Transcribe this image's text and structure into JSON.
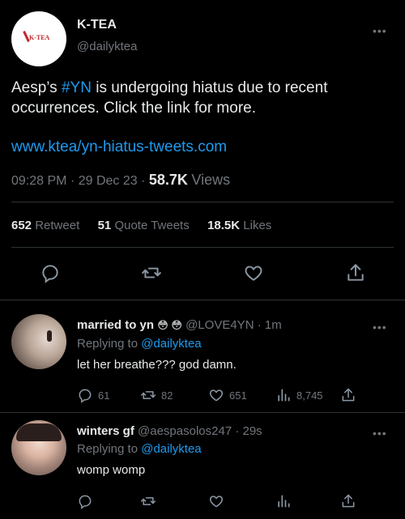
{
  "header": {
    "display_name": "K-TEA",
    "handle": "@dailyktea",
    "logo_text": "K-TEA"
  },
  "tweet": {
    "text_pre": "Aesp’s ",
    "hashtag": "#YN",
    "text_post": " is undergoing hiatus due to recent occurrences. Click the link for more.",
    "link": "www.ktea/yn-hiatus-tweets.com",
    "time": "09:28 PM",
    "sep1": "·",
    "date": "29 Dec 23",
    "sep2": "·",
    "views_count": "58.7K",
    "views_label": "Views"
  },
  "stats": {
    "retweets_count": "652",
    "retweets_label": "Retweet",
    "quotes_count": "51",
    "quotes_label": "Quote Tweets",
    "likes_count": "18.5K",
    "likes_label": "Likes"
  },
  "replies": [
    {
      "name": "married to yn",
      "emoji": "😳 😳",
      "handle": "@LOVE4YN",
      "sep": "·",
      "time": "1m",
      "replying_label": "Replying to",
      "replying_to": "@dailyktea",
      "text": "let her breathe??? god damn.",
      "reply_count": "61",
      "retweet_count": "82",
      "like_count": "651",
      "view_count": "8,745"
    },
    {
      "name": "winters gf",
      "handle": "@aespasolos247",
      "sep": "·",
      "time": "29s",
      "replying_label": "Replying to",
      "replying_to": "@dailyktea",
      "text": "womp womp"
    }
  ],
  "colors": {
    "background": "#000000",
    "text": "#e7e9ea",
    "muted": "#71767b",
    "link": "#1d9bf0",
    "divider": "#2f3336",
    "logo_red": "#c0272d"
  }
}
